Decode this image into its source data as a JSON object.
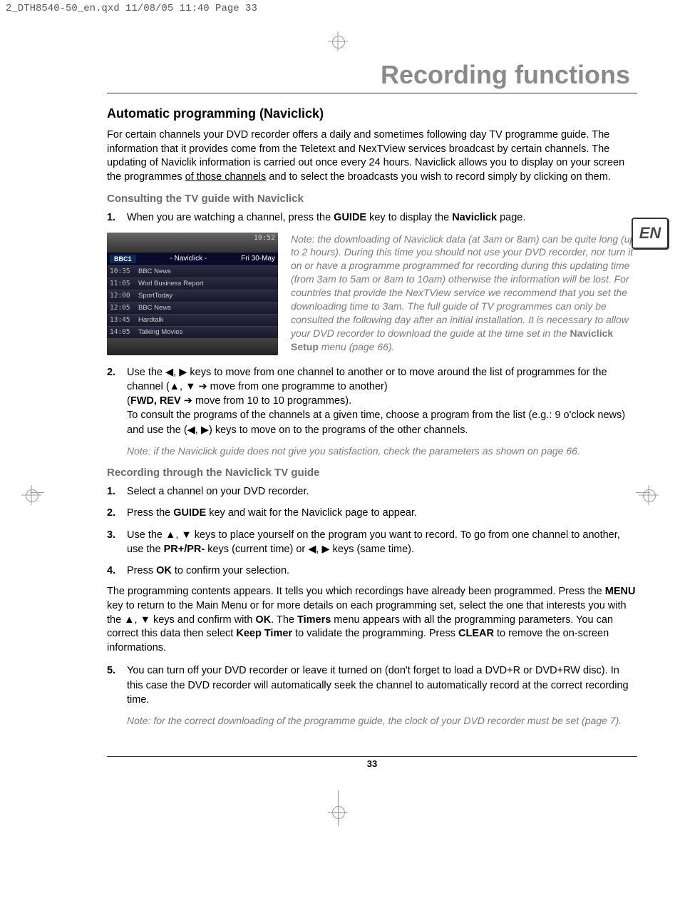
{
  "print_header": "2_DTH8540-50_en.qxd  11/08/05  11:40  Page 33",
  "page_title": "Recording functions",
  "lang_flag": "EN",
  "page_number": "33",
  "section_heading": "Automatic programming (Naviclick)",
  "intro_para": "For certain channels your DVD recorder offers a daily and sometimes following day TV programme guide. The information that it provides come from the Teletext and NexTView services broadcast by certain channels. The updating of Naviclik information is carried out once every 24 hours. Naviclick allows you to display on your screen the programmes ",
  "intro_underline": "of those channels",
  "intro_tail": " and to select the broadcasts you wish to record simply by clicking on them.",
  "sub_consulting": "Consulting the TV guide with Naviclick",
  "step1_pre": "When you are watching a channel, press the ",
  "step1_key": "GUIDE",
  "step1_mid": " key to display the ",
  "step1_page": "Naviclick",
  "step1_tail": " page.",
  "screen": {
    "clock": "10:52",
    "channel": "BBC1",
    "title": "- Naviclick -",
    "date": "Fri 30-May",
    "rows": [
      {
        "t": "10:35",
        "p": "BBC News"
      },
      {
        "t": "11:05",
        "p": "Worl Business Report"
      },
      {
        "t": "12:00",
        "p": "SportToday"
      },
      {
        "t": "12:05",
        "p": "BBC News"
      },
      {
        "t": "13:45",
        "p": "Hardtalk"
      },
      {
        "t": "14:05",
        "p": "Talking Movies"
      }
    ]
  },
  "note1_pre": "Note: the downloading of Naviclick data (at 3am or 8am) can be quite long (up to 2 hours). During this time you should not use your DVD recorder, nor turn it on or have a programme programmed for recording during this updating time (from 3am to 5am or 8am to 10am) otherwise the information will be lost. For countries that provide the NexTView service we recommend that you set the downloading time to 3am. The full guide of TV programmes can only be consulted the following day after an initial installation. It is necessary to allow your DVD recorder to download the guide at the time set in the ",
  "note1_bold": "Naviclick Setup",
  "note1_tail": " menu (page 66).",
  "step2_line1_pre": "Use the ",
  "arrows_lr": "◀, ▶",
  "step2_line1_mid": " keys to move from one channel to another or to move around the list of programmes for the channel (",
  "arrows_ud": "▲, ▼",
  "arrow_right": " ➔",
  "step2_line1_tail": " move from one programme to another)",
  "step2_line2_pre": "(",
  "step2_fwdrev": "FWD, REV",
  "step2_line2_tail": " ➔ move from 10 to 10 programmes).",
  "step2_line3": "To consult the programs of the channels at a given time, choose a program from the list (e.g.: 9 o'clock news) and use the (◀, ▶) keys to move on to the programs of the other channels.",
  "note2": "Note: if the Naviclick guide does not give you satisfaction, check the parameters as shown on page 66.",
  "sub_recording": "Recording through the Naviclick TV guide",
  "r_step1": "Select a channel on your DVD recorder.",
  "r_step2_pre": "Press the ",
  "r_step2_key": "GUIDE",
  "r_step2_tail": " key and wait for the Naviclick page to appear.",
  "r_step3_pre": "Use the ",
  "r_step3_mid": " keys to place yourself on the program you want to record. To go from one channel to another, use the ",
  "r_step3_prpr": "PR+/PR-",
  "r_step3_tail": " keys (current time) or ◀, ▶ keys (same time).",
  "r_step4_pre": "Press ",
  "r_step4_ok": "OK",
  "r_step4_tail": " to confirm your selection.",
  "prog_para_pre": "The programming contents appears. It tells you which recordings have already been programmed. Press the ",
  "menu_key": "MENU",
  "prog_para_mid1": " key to return to the Main Menu or for more details on each programming set, select the one that interests you with the ▲, ▼ keys and confirm with ",
  "ok_key": "OK",
  "prog_para_mid2": ". The ",
  "timers": "Timers",
  "prog_para_mid3": " menu appears with all the programming parameters. You can correct this data then select ",
  "keep_timer": "Keep Timer",
  "prog_para_mid4": " to validate the programming. Press ",
  "clear_key": "CLEAR",
  "prog_para_tail": " to remove the on-screen informations.",
  "r_step5": "You can turn off your DVD recorder or leave it turned on (don't forget to load a DVD+R or DVD+RW disc). In this case the DVD recorder will automatically seek the channel to automatically record at the correct recording time.",
  "note3": "Note: for the correct downloading of the programme guide, the clock of your DVD recorder must be set (page 7)."
}
